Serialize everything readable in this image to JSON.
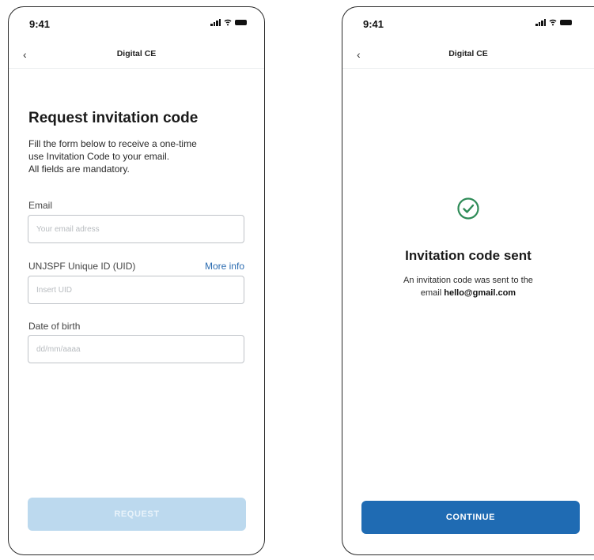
{
  "status_bar": {
    "time": "9:41"
  },
  "nav": {
    "title": "Digital CE",
    "back_icon": "chevron-left-icon"
  },
  "request_screen": {
    "title": "Request invitation code",
    "description_lines": [
      "Fill the form below to receive a one-time",
      "use Invitation Code to your email.",
      "All fields are mandatory."
    ],
    "email": {
      "label": "Email",
      "placeholder": "Your email adress",
      "value": ""
    },
    "uid": {
      "label": "UNJSPF Unique ID (UID)",
      "more_info": "More info",
      "placeholder": "Insert UID",
      "value": ""
    },
    "dob": {
      "label": "Date of birth",
      "placeholder": "dd/mm/aaaa",
      "value": ""
    },
    "submit_label": "REQUEST"
  },
  "sent_screen": {
    "title": "Invitation code sent",
    "message_line1": "An invitation code was sent to the",
    "message_prefix": "email",
    "email": "hello@gmail.com",
    "continue_label": "CONTINUE",
    "success_icon": "check-circle-icon"
  },
  "colors": {
    "primary": "#1f6bb3",
    "primary_disabled": "#bcd9ee",
    "success": "#2e8b57",
    "link": "#2a6bb0"
  }
}
